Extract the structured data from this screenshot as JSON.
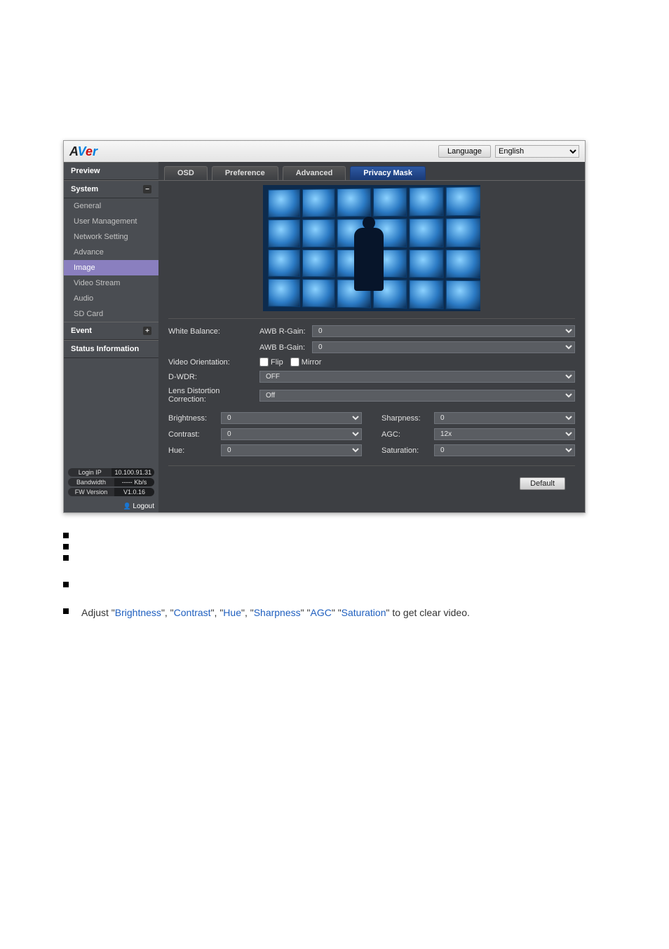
{
  "topbar": {
    "language_label": "Language",
    "language_value": "English"
  },
  "sidebar": {
    "preview": "Preview",
    "system": "System",
    "items": [
      "General",
      "User Management",
      "Network Setting",
      "Advance",
      "Image",
      "Video Stream",
      "Audio",
      "SD Card"
    ],
    "event": "Event",
    "status_info": "Status Information",
    "login_ip_label": "Login IP",
    "login_ip_value": "10.100.91.31",
    "bandwidth_label": "Bandwidth",
    "bandwidth_value": "----- Kb/s",
    "fw_label": "FW Version",
    "fw_value": "V1.0.16",
    "logout": "Logout"
  },
  "tabs": {
    "osd": "OSD",
    "preference": "Preference",
    "advanced": "Advanced",
    "privacy_mask": "Privacy Mask"
  },
  "form": {
    "white_balance": "White Balance:",
    "awb_r_gain": "AWB R-Gain:",
    "awb_r_gain_val": "0",
    "awb_b_gain": "AWB B-Gain:",
    "awb_b_gain_val": "0",
    "video_orientation": "Video Orientation:",
    "flip": "Flip",
    "mirror": "Mirror",
    "dwdr": "D-WDR:",
    "dwdr_val": "OFF",
    "ldc": "Lens Distortion Correction:",
    "ldc_val": "Off",
    "brightness": "Brightness:",
    "brightness_val": "0",
    "sharpness": "Sharpness:",
    "sharpness_val": "0",
    "contrast": "Contrast:",
    "contrast_val": "0",
    "agc": "AGC:",
    "agc_val": "12x",
    "hue": "Hue:",
    "hue_val": "0",
    "saturation": "Saturation:",
    "saturation_val": "0",
    "default_btn": "Default"
  },
  "bullets": {
    "adjust_prefix": "Adjust \"",
    "sep1": "\", \"",
    "sep2": "\", \"",
    "sep3": "\", \"",
    "sep4": "\" \"",
    "sep5": "\" \"",
    "suffix": "\" to get clear video.",
    "terms": [
      "Brightness",
      "Contrast",
      "Hue",
      "Sharpness",
      "AGC",
      "Saturation"
    ]
  }
}
